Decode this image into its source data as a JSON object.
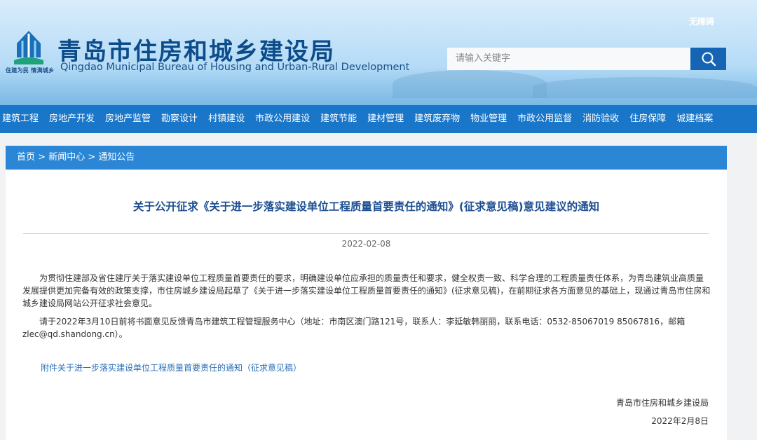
{
  "header": {
    "title_cn": "青岛市住房和城乡建设局",
    "title_en": "Qingdao Municipal Bureau of Housing and Urban-Rural Development",
    "slogan": "住建为民 情满城乡",
    "accessibility_label": "无障碍",
    "search_placeholder": "请输入关键字",
    "search_icon": "magnifier-icon"
  },
  "nav": {
    "items": [
      "建筑工程",
      "房地产开发",
      "房地产监管",
      "勘察设计",
      "村镇建设",
      "市政公用建设",
      "建筑节能",
      "建材管理",
      "建筑废弃物",
      "物业管理",
      "市政公用监督",
      "消防验收",
      "住房保障",
      "城建档案"
    ]
  },
  "breadcrumb": {
    "home": "首页",
    "sep": ">",
    "section": "新闻中心",
    "current": "通知公告"
  },
  "article": {
    "title": "关于公开征求《关于进一步落实建设单位工程质量首要责任的通知》(征求意见稿)意见建议的通知",
    "date": "2022-02-08",
    "paragraph1": "为贯彻住建部及省住建厅关于落实建设单位工程质量首要责任的要求，明确建设单位应承担的质量责任和要求，健全权责一致、科学合理的工程质量责任体系，为青岛建筑业高质量发展提供更加完备有效的政策支撑，市住房城乡建设局起草了《关于进一步落实建设单位工程质量首要责任的通知》(征求意见稿)，在前期征求各方面意见的基础上，现通过青岛市住房和城乡建设局网站公开征求社会意见。",
    "paragraph2": "请于2022年3月10日前将书面意见反馈青岛市建筑工程管理服务中心（地址：市南区澳门路121号，联系人：李延敏韩丽丽，联系电话：0532-85067019 85067816，邮箱zlec@qd.shandong.cn）。",
    "attachment_link": "附件关于进一步落实建设单位工程质量首要责任的通知（征求意见稿）",
    "signature_org": "青岛市住房和城乡建设局",
    "signature_date": "2022年2月8日"
  },
  "colors": {
    "nav_bg": "#1976c8",
    "breadcrumb_bg": "#2b87d6",
    "title_blue": "#1d4f91",
    "search_button": "#1565b4"
  }
}
